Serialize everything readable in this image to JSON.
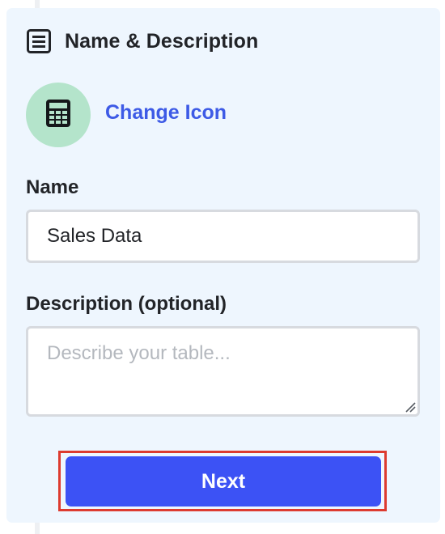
{
  "section": {
    "title": "Name & Description",
    "icon": "document-list-icon"
  },
  "table_icon": {
    "icon": "calculator-icon",
    "background_color": "#b4e4cb",
    "change_label": "Change Icon"
  },
  "form": {
    "name_label": "Name",
    "name_value": "Sales Data",
    "description_label": "Description (optional)",
    "description_placeholder": "Describe your table..."
  },
  "actions": {
    "next_label": "Next"
  },
  "colors": {
    "panel_background": "#eef6fe",
    "accent": "#3c52f5",
    "link": "#3d5ae6",
    "highlight_border": "#dd3b2f"
  }
}
